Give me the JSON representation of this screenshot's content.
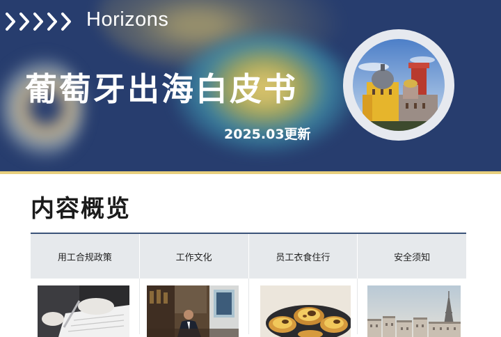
{
  "header": {
    "brand": "Horizons",
    "title": "葡萄牙出海白皮书",
    "date": "2025.03更新",
    "accent_color": "#273d6e",
    "gold_color": "#e7cf7d"
  },
  "overview": {
    "title": "内容概览",
    "tabs": [
      {
        "label": "用工合规政策"
      },
      {
        "label": "工作文化"
      },
      {
        "label": "员工衣食住行"
      },
      {
        "label": "安全须知"
      }
    ],
    "images": [
      {
        "icon": "document-signing-photo"
      },
      {
        "icon": "office-meeting-photo"
      },
      {
        "icon": "pastel-de-nata-photo"
      },
      {
        "icon": "paris-skyline-photo"
      }
    ]
  }
}
